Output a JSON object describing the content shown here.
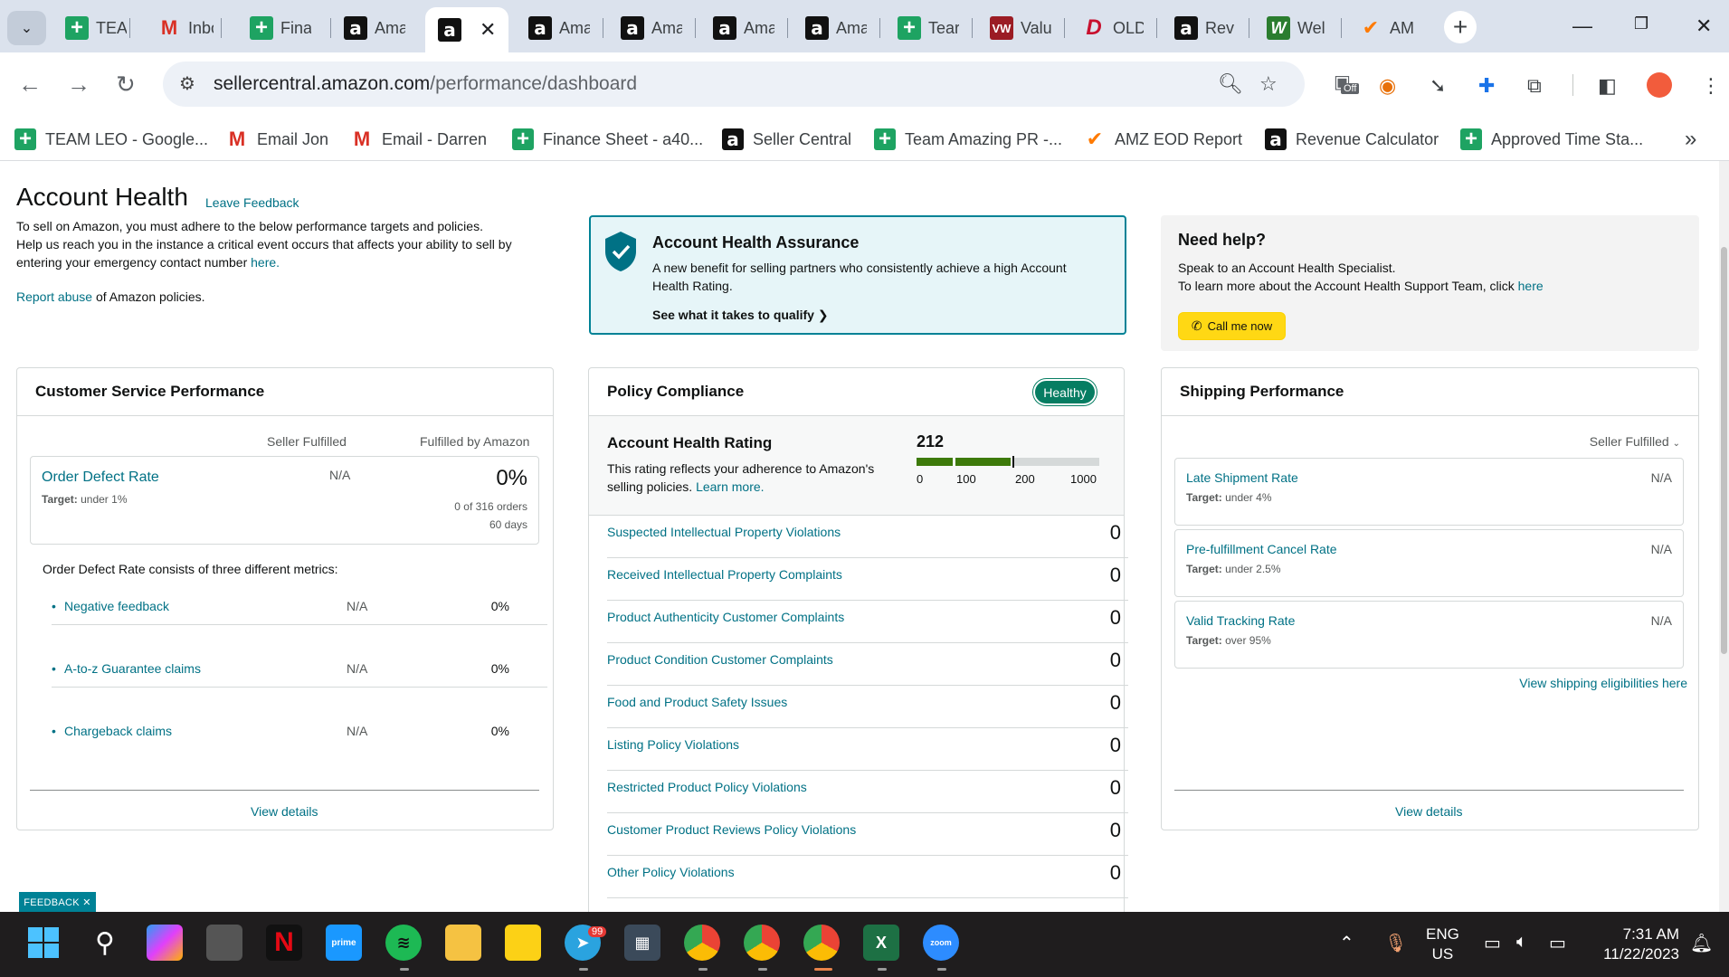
{
  "browser": {
    "tabs": [
      {
        "label": "TEAI",
        "icon": "sheets-icon"
      },
      {
        "label": "Inbo",
        "icon": "gmail-icon"
      },
      {
        "label": "Fina",
        "icon": "sheets-icon"
      },
      {
        "label": "Ama",
        "icon": "amazon-icon"
      },
      {
        "label": "",
        "icon": "amazon-icon",
        "active": true
      },
      {
        "label": "Ama",
        "icon": "amazon-icon"
      },
      {
        "label": "Ama",
        "icon": "amazon-icon"
      },
      {
        "label": "Ama",
        "icon": "amazon-icon"
      },
      {
        "label": "Ama",
        "icon": "amazon-icon"
      },
      {
        "label": "Tear",
        "icon": "sheets-icon"
      },
      {
        "label": "Valu",
        "icon": "vw-icon"
      },
      {
        "label": "OLD",
        "icon": "pinterest-icon"
      },
      {
        "label": "Rev",
        "icon": "amazon-icon"
      },
      {
        "label": "Wel",
        "icon": "w-icon"
      },
      {
        "label": "AM",
        "icon": "amz-eod-icon"
      }
    ],
    "url_host": "sellercentral.amazon.com",
    "url_path": "/performance/dashboard",
    "ext_badge": "Off",
    "bookmarks": [
      {
        "label": "TEAM LEO - Google...",
        "icon": "sheets-icon"
      },
      {
        "label": "Email Jon",
        "icon": "gmail-icon"
      },
      {
        "label": "Email - Darren",
        "icon": "gmail-icon"
      },
      {
        "label": "Finance Sheet - a40...",
        "icon": "sheets-icon"
      },
      {
        "label": "Seller Central",
        "icon": "amazon-icon"
      },
      {
        "label": "Team Amazing PR -...",
        "icon": "sheets-icon"
      },
      {
        "label": "AMZ EOD Report",
        "icon": "amz-eod-icon"
      },
      {
        "label": "Revenue Calculator",
        "icon": "amazon-icon"
      },
      {
        "label": "Approved Time Sta...",
        "icon": "sheets-icon"
      }
    ],
    "bookmarks_more": "»"
  },
  "header": {
    "title": "Account Health",
    "leave_feedback": "Leave Feedback",
    "intro_line1": "To sell on Amazon, you must adhere to the below performance targets and policies.",
    "intro_line2": "Help us reach you in the instance a critical event occurs that affects your ability to sell by",
    "intro_line3": "entering your emergency contact number ",
    "intro_here": "here.",
    "report_abuse": "Report abuse",
    "report_rest": " of Amazon policies."
  },
  "assurance": {
    "title": "Account Health Assurance",
    "desc": "A new benefit for selling partners who consistently achieve a high Account Health Rating.",
    "link": "See what it takes to qualify"
  },
  "help": {
    "title": "Need help?",
    "line1": "Speak to an Account Health Specialist.",
    "line2": "To learn more about the Account Health Support Team, click ",
    "here": "here",
    "call_btn": "Call me now"
  },
  "customer_service": {
    "title": "Customer Service Performance",
    "col_seller": "Seller Fulfilled",
    "col_fba": "Fulfilled by Amazon",
    "odr_label": "Order Defect Rate",
    "odr_target_label": "Target:",
    "odr_target": " under 1%",
    "odr_seller": "N/A",
    "odr_fba": "0%",
    "odr_orders": "0 of 316 orders",
    "odr_days": "60 days",
    "consists": "Order Defect Rate consists of three different metrics:",
    "metrics": [
      {
        "label": "Negative feedback",
        "seller": "N/A",
        "fba": "0%"
      },
      {
        "label": "A-to-z Guarantee claims",
        "seller": "N/A",
        "fba": "0%"
      },
      {
        "label": "Chargeback claims",
        "seller": "N/A",
        "fba": "0%"
      }
    ],
    "view_details": "View details"
  },
  "policy": {
    "title": "Policy Compliance",
    "status": "Healthy",
    "ahr_title": "Account Health Rating",
    "ahr_desc1": "This rating reflects your adherence to Amazon's",
    "ahr_desc2": "selling policies. ",
    "ahr_learn": "Learn more.",
    "ahr_value": "212",
    "ahr_ticks": [
      "0",
      "100",
      "200",
      "1000"
    ],
    "violations": [
      {
        "label": "Suspected Intellectual Property Violations",
        "value": "0"
      },
      {
        "label": "Received Intellectual Property Complaints",
        "value": "0"
      },
      {
        "label": "Product Authenticity Customer Complaints",
        "value": "0"
      },
      {
        "label": "Product Condition Customer Complaints",
        "value": "0"
      },
      {
        "label": "Food and Product Safety Issues",
        "value": "0"
      },
      {
        "label": "Listing Policy Violations",
        "value": "0"
      },
      {
        "label": "Restricted Product Policy Violations",
        "value": "0"
      },
      {
        "label": "Customer Product Reviews Policy Violations",
        "value": "0"
      },
      {
        "label": "Other Policy Violations",
        "value": "0"
      }
    ]
  },
  "shipping": {
    "title": "Shipping Performance",
    "filter": "Seller Fulfilled",
    "metrics": [
      {
        "label": "Late Shipment Rate",
        "target_label": "Target:",
        "target": " under 4%",
        "value": "N/A"
      },
      {
        "label": "Pre-fulfillment Cancel Rate",
        "target_label": "Target:",
        "target": " under 2.5%",
        "value": "N/A"
      },
      {
        "label": "Valid Tracking Rate",
        "target_label": "Target:",
        "target": " over 95%",
        "value": "N/A"
      }
    ],
    "eligibilities_link": "View shipping eligibilities here",
    "view_details": "View details"
  },
  "feedback_tab": "FEEDBACK ✕",
  "taskbar": {
    "telegram_badge": "99",
    "lang1": "ENG",
    "lang2": "US",
    "time": "7:31 AM",
    "date": "11/22/2023"
  }
}
